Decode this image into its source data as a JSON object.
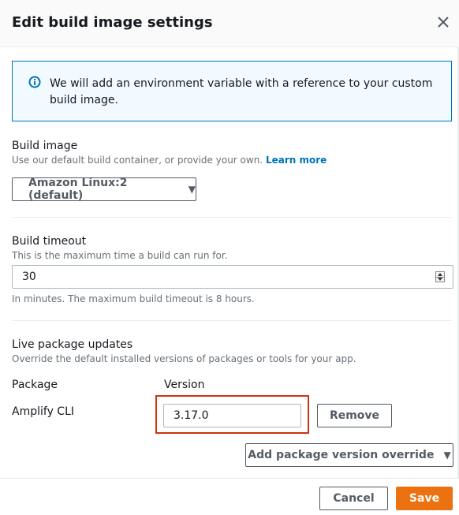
{
  "modal": {
    "title": "Edit build image settings",
    "close_icon": "close-icon"
  },
  "alert": {
    "icon": "info-icon",
    "text": "We will add an environment variable with a reference to your custom build image.",
    "accent_color": "#0073bb"
  },
  "build_image": {
    "label": "Build image",
    "description": "Use our default build container, or provide your own.",
    "learn_more": "Learn more",
    "selected": "Amazon Linux:2 (default)"
  },
  "build_timeout": {
    "label": "Build timeout",
    "description": "This is the maximum time a build can run for.",
    "value": "30",
    "hint": "In minutes. The maximum build timeout is 8 hours."
  },
  "live_packages": {
    "label": "Live package updates",
    "description": "Override the default installed versions of packages or tools for your app.",
    "column_package": "Package",
    "column_version": "Version",
    "rows": [
      {
        "package": "Amplify CLI",
        "version": "3.17.0",
        "remove_label": "Remove"
      }
    ],
    "add_override_label": "Add package version override"
  },
  "footer": {
    "cancel_label": "Cancel",
    "save_label": "Save",
    "primary_color": "#ec7211"
  }
}
